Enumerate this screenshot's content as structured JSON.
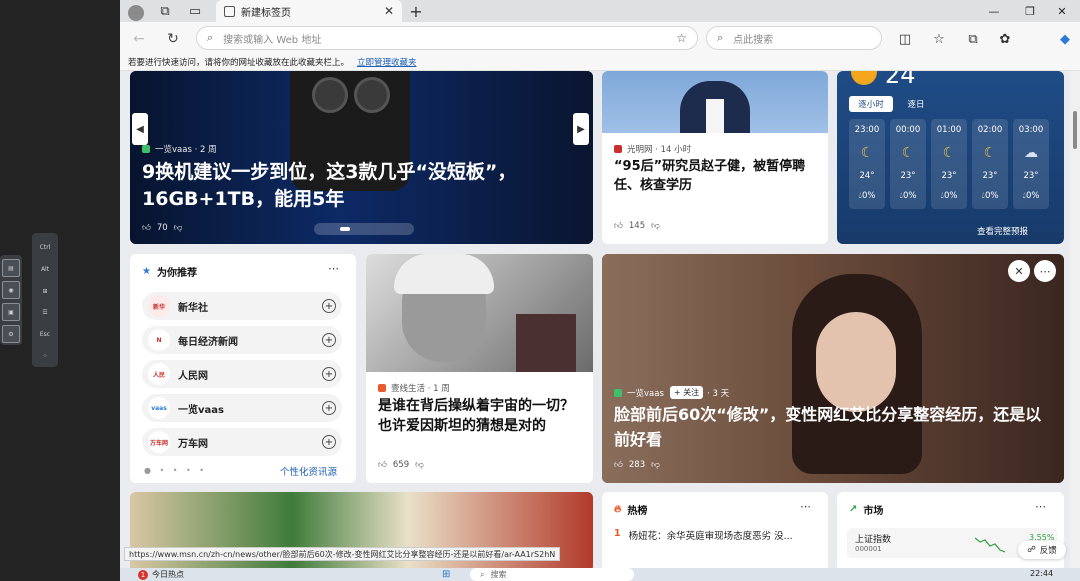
{
  "browser": {
    "tab_title": "新建标签页",
    "address_placeholder": "搜索或输入 Web 地址",
    "search_placeholder": "点此搜索",
    "favbar_text": "若要进行快速访问，请将你的网址收藏放在此收藏夹栏上。",
    "favbar_link": "立即管理收藏夹"
  },
  "float_toolbar": {
    "labels": [
      "Ctrl",
      "Alt",
      "Esc"
    ]
  },
  "hero": {
    "source": "一览vaas · 2 周",
    "headline": "9换机建议一步到位，这3款几乎“没短板”，16GB+1TB，能用5年",
    "likes": "70"
  },
  "news1": {
    "source": "光明网 · 14 小时",
    "headline": "“95后”研究员赵子健，被暂停聘任、核查学历",
    "likes": "145"
  },
  "weather": {
    "temp": "24",
    "tab_hourly": "逐小时",
    "tab_daily": "逐日",
    "hours": [
      {
        "time": "23:00",
        "deg": "24°",
        "pct": "0%"
      },
      {
        "time": "00:00",
        "deg": "23°",
        "pct": "0%"
      },
      {
        "time": "01:00",
        "deg": "23°",
        "pct": "0%"
      },
      {
        "time": "02:00",
        "deg": "23°",
        "pct": "0%"
      },
      {
        "time": "03:00",
        "deg": "23°",
        "pct": "0%"
      }
    ],
    "more": "查看完整预报"
  },
  "foryou": {
    "title": "为你推荐",
    "publishers": [
      {
        "name": "新华社",
        "logo": "新华"
      },
      {
        "name": "每日经济新闻",
        "logo": "N"
      },
      {
        "name": "人民网",
        "logo": "人民"
      },
      {
        "name": "一览vaas",
        "logo": "vaas"
      },
      {
        "name": "万车网",
        "logo": "万车网"
      }
    ],
    "link": "个性化资讯源"
  },
  "einstein": {
    "source": "壹线生活 · 1 周",
    "headline": "是谁在背后操纵着宇宙的一切？也许爱因斯坦的猜想是对的",
    "likes": "659"
  },
  "big": {
    "source": "一览vaas",
    "follow": "+ 关注",
    "age": "· 3 天",
    "headline": "脸部前后60次“修改”，变性网红艾比分享整容经历，还是以前好看",
    "likes": "283"
  },
  "hot": {
    "title": "热榜",
    "item_rank": "1",
    "item_text": "杨妞花：余华英庭审现场态度恶劣 没..."
  },
  "market": {
    "title": "市场",
    "index_name": "上证指数",
    "index_code": "000001",
    "change": "3.55%"
  },
  "status_url": "https://www.msn.cn/zh-cn/news/other/脸部前后60次-修改-变性网红艾比分享整容经历-还是以前好看/ar-AA1rS2hN",
  "feedback": "反馈",
  "taskbar": {
    "left_badge": "1",
    "left_text": "今日热点",
    "search": "搜索",
    "time": "22:44"
  }
}
